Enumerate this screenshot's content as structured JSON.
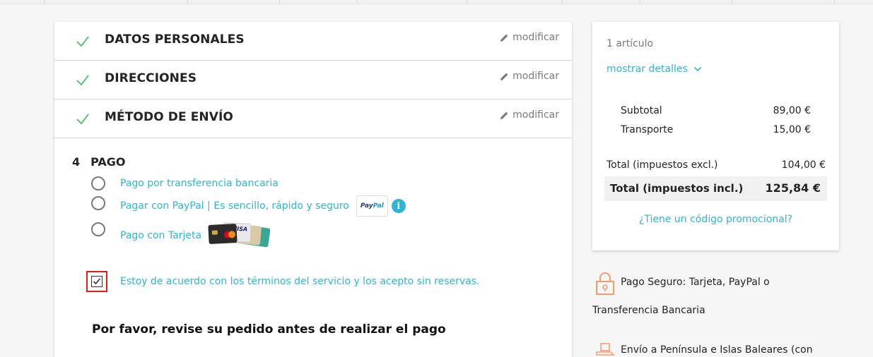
{
  "checkout": {
    "steps_done": [
      {
        "title": "DATOS PERSONALES",
        "edit": "modificar"
      },
      {
        "title": "DIRECCIONES",
        "edit": "modificar"
      },
      {
        "title": "MÉTODO DE ENVÍO",
        "edit": "modificar"
      }
    ],
    "payment": {
      "number": "4",
      "title": "PAGO",
      "options": [
        {
          "label": "Pago por transferencia bancaria"
        },
        {
          "label": "Pagar con PayPal | Es sencillo, rápido y seguro",
          "logo_text_a": "Pay",
          "logo_text_b": "Pal",
          "info": "i"
        },
        {
          "label": "Pago con Tarjeta",
          "card_brand": "VISA"
        }
      ],
      "terms_label": "Estoy de acuerdo con los términos del servicio y los acepto sin reservas.",
      "terms_checked": true
    },
    "review_heading": "Por favor, revise su pedido antes de realizar el pago"
  },
  "summary": {
    "items_count": "1 artículo",
    "show_details": "mostrar detalles",
    "subtotal_label": "Subtotal",
    "subtotal_value": "89,00 €",
    "shipping_label": "Transporte",
    "shipping_value": "15,00 €",
    "total_excl_label": "Total (impuestos excl.)",
    "total_excl_value": "104,00 €",
    "total_incl_label": "Total (impuestos incl.)",
    "total_incl_value": "125,84 €",
    "promo_link": "¿Tiene un código promocional?"
  },
  "reassurance": {
    "secure_line1": "Pago Seguro: Tarjeta, PayPal o",
    "secure_line2": "Transferencia Bancaria",
    "shipping_line1": "Envío a Península e Islas Baleares (con"
  },
  "colors": {
    "accent": "#2fb5d2",
    "check": "#4cbb6c",
    "highlight": "#e21b1b",
    "icon_orange": "#f39d72"
  }
}
